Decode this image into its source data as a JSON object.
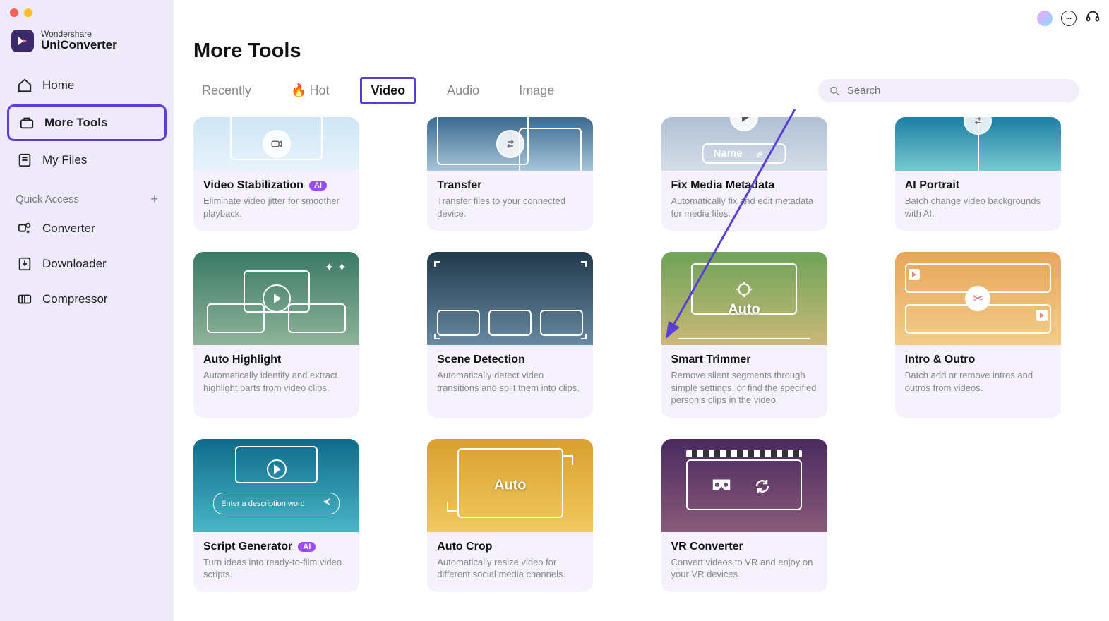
{
  "brand": {
    "small": "Wondershare",
    "large": "UniConverter"
  },
  "sidebar": {
    "items": [
      {
        "label": "Home"
      },
      {
        "label": "More Tools"
      },
      {
        "label": "My Files"
      }
    ],
    "quick_access_label": "Quick Access",
    "quick": [
      {
        "label": "Converter"
      },
      {
        "label": "Downloader"
      },
      {
        "label": "Compressor"
      }
    ]
  },
  "page": {
    "title": "More Tools"
  },
  "tabs": {
    "recently": "Recently",
    "hot": "Hot",
    "video": "Video",
    "audio": "Audio",
    "image": "Image"
  },
  "search": {
    "placeholder": "Search"
  },
  "cards": {
    "video_stabilization": {
      "title": "Video Stabilization",
      "desc": "Eliminate video jitter for smoother playback.",
      "badge": "AI"
    },
    "transfer": {
      "title": "Transfer",
      "desc": "Transfer files to your connected device."
    },
    "fix_metadata": {
      "title": "Fix Media Metadata",
      "desc": "Automatically fix and edit metadata for media files.",
      "overlay_name": "Name"
    },
    "ai_portrait": {
      "title": "AI Portrait",
      "desc": "Batch change video backgrounds with AI."
    },
    "auto_highlight": {
      "title": "Auto Highlight",
      "desc": "Automatically identify and extract highlight parts from video clips."
    },
    "scene_detection": {
      "title": "Scene Detection",
      "desc": "Automatically detect video transitions and split them into clips."
    },
    "smart_trimmer": {
      "title": "Smart Trimmer",
      "desc": "Remove silent segments through simple settings, or find the specified person's clips in the video.",
      "overlay_auto": "Auto"
    },
    "intro_outro": {
      "title": "Intro & Outro",
      "desc": "Batch add or remove intros and outros from videos."
    },
    "script_generator": {
      "title": "Script Generator",
      "desc": "Turn ideas into ready-to-film video scripts.",
      "badge": "AI",
      "overlay_placeholder": "Enter a description word"
    },
    "auto_crop": {
      "title": "Auto Crop",
      "desc": "Automatically resize video for different social media channels.",
      "overlay_auto": "Auto"
    },
    "vr_converter": {
      "title": "VR Converter",
      "desc": "Convert videos to VR and enjoy on your VR devices."
    }
  }
}
